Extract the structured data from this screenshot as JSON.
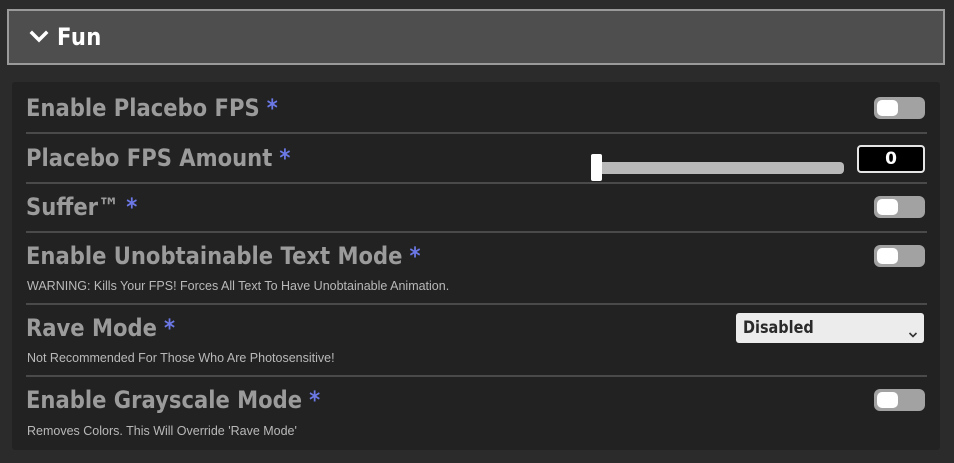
{
  "section": {
    "title": "Fun",
    "expand_icon": "chevron-down-icon"
  },
  "settings": {
    "placebo_fps": {
      "label": "Enable Placebo FPS",
      "asterisk": "*",
      "enabled": false
    },
    "placebo_fps_amount": {
      "label": "Placebo FPS Amount",
      "asterisk": "*",
      "value": "0",
      "slider_fraction": 0
    },
    "suffer": {
      "label": "Suffer™",
      "asterisk": "*",
      "enabled": false
    },
    "unobtainable_text": {
      "label": "Enable Unobtainable Text Mode",
      "asterisk": "*",
      "description": "WARNING: Kills Your FPS! Forces All Text To Have Unobtainable Animation.",
      "enabled": false
    },
    "rave_mode": {
      "label": "Rave Mode",
      "asterisk": "*",
      "description": "Not Recommended For Those Who Are Photosensitive!",
      "selected": "Disabled"
    },
    "grayscale": {
      "label": "Enable Grayscale Mode",
      "asterisk": "*",
      "description": "Removes Colors. This Will Override 'Rave Mode'",
      "enabled": false
    }
  },
  "colors": {
    "asterisk": "#6b78e6",
    "label": "#9b9b9b",
    "panel": "#222222",
    "header": "#4e4e4e"
  }
}
